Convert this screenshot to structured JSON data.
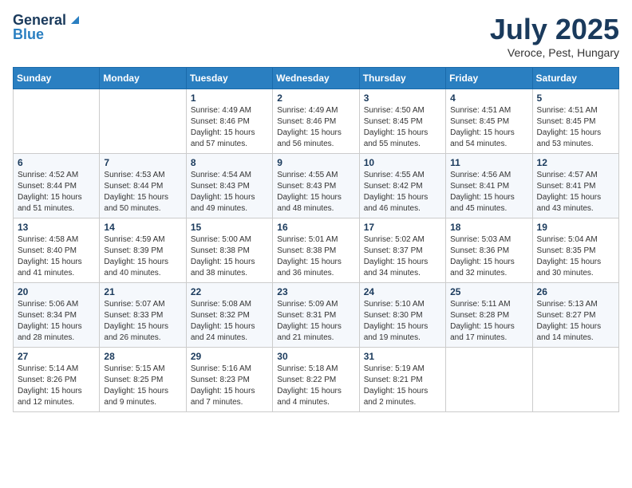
{
  "logo": {
    "general": "General",
    "blue": "Blue"
  },
  "title": {
    "month": "July 2025",
    "location": "Veroce, Pest, Hungary"
  },
  "days_header": [
    "Sunday",
    "Monday",
    "Tuesday",
    "Wednesday",
    "Thursday",
    "Friday",
    "Saturday"
  ],
  "weeks": [
    [
      {
        "day": "",
        "info": ""
      },
      {
        "day": "",
        "info": ""
      },
      {
        "day": "1",
        "info": "Sunrise: 4:49 AM\nSunset: 8:46 PM\nDaylight: 15 hours and 57 minutes."
      },
      {
        "day": "2",
        "info": "Sunrise: 4:49 AM\nSunset: 8:46 PM\nDaylight: 15 hours and 56 minutes."
      },
      {
        "day": "3",
        "info": "Sunrise: 4:50 AM\nSunset: 8:45 PM\nDaylight: 15 hours and 55 minutes."
      },
      {
        "day": "4",
        "info": "Sunrise: 4:51 AM\nSunset: 8:45 PM\nDaylight: 15 hours and 54 minutes."
      },
      {
        "day": "5",
        "info": "Sunrise: 4:51 AM\nSunset: 8:45 PM\nDaylight: 15 hours and 53 minutes."
      }
    ],
    [
      {
        "day": "6",
        "info": "Sunrise: 4:52 AM\nSunset: 8:44 PM\nDaylight: 15 hours and 51 minutes."
      },
      {
        "day": "7",
        "info": "Sunrise: 4:53 AM\nSunset: 8:44 PM\nDaylight: 15 hours and 50 minutes."
      },
      {
        "day": "8",
        "info": "Sunrise: 4:54 AM\nSunset: 8:43 PM\nDaylight: 15 hours and 49 minutes."
      },
      {
        "day": "9",
        "info": "Sunrise: 4:55 AM\nSunset: 8:43 PM\nDaylight: 15 hours and 48 minutes."
      },
      {
        "day": "10",
        "info": "Sunrise: 4:55 AM\nSunset: 8:42 PM\nDaylight: 15 hours and 46 minutes."
      },
      {
        "day": "11",
        "info": "Sunrise: 4:56 AM\nSunset: 8:41 PM\nDaylight: 15 hours and 45 minutes."
      },
      {
        "day": "12",
        "info": "Sunrise: 4:57 AM\nSunset: 8:41 PM\nDaylight: 15 hours and 43 minutes."
      }
    ],
    [
      {
        "day": "13",
        "info": "Sunrise: 4:58 AM\nSunset: 8:40 PM\nDaylight: 15 hours and 41 minutes."
      },
      {
        "day": "14",
        "info": "Sunrise: 4:59 AM\nSunset: 8:39 PM\nDaylight: 15 hours and 40 minutes."
      },
      {
        "day": "15",
        "info": "Sunrise: 5:00 AM\nSunset: 8:38 PM\nDaylight: 15 hours and 38 minutes."
      },
      {
        "day": "16",
        "info": "Sunrise: 5:01 AM\nSunset: 8:38 PM\nDaylight: 15 hours and 36 minutes."
      },
      {
        "day": "17",
        "info": "Sunrise: 5:02 AM\nSunset: 8:37 PM\nDaylight: 15 hours and 34 minutes."
      },
      {
        "day": "18",
        "info": "Sunrise: 5:03 AM\nSunset: 8:36 PM\nDaylight: 15 hours and 32 minutes."
      },
      {
        "day": "19",
        "info": "Sunrise: 5:04 AM\nSunset: 8:35 PM\nDaylight: 15 hours and 30 minutes."
      }
    ],
    [
      {
        "day": "20",
        "info": "Sunrise: 5:06 AM\nSunset: 8:34 PM\nDaylight: 15 hours and 28 minutes."
      },
      {
        "day": "21",
        "info": "Sunrise: 5:07 AM\nSunset: 8:33 PM\nDaylight: 15 hours and 26 minutes."
      },
      {
        "day": "22",
        "info": "Sunrise: 5:08 AM\nSunset: 8:32 PM\nDaylight: 15 hours and 24 minutes."
      },
      {
        "day": "23",
        "info": "Sunrise: 5:09 AM\nSunset: 8:31 PM\nDaylight: 15 hours and 21 minutes."
      },
      {
        "day": "24",
        "info": "Sunrise: 5:10 AM\nSunset: 8:30 PM\nDaylight: 15 hours and 19 minutes."
      },
      {
        "day": "25",
        "info": "Sunrise: 5:11 AM\nSunset: 8:28 PM\nDaylight: 15 hours and 17 minutes."
      },
      {
        "day": "26",
        "info": "Sunrise: 5:13 AM\nSunset: 8:27 PM\nDaylight: 15 hours and 14 minutes."
      }
    ],
    [
      {
        "day": "27",
        "info": "Sunrise: 5:14 AM\nSunset: 8:26 PM\nDaylight: 15 hours and 12 minutes."
      },
      {
        "day": "28",
        "info": "Sunrise: 5:15 AM\nSunset: 8:25 PM\nDaylight: 15 hours and 9 minutes."
      },
      {
        "day": "29",
        "info": "Sunrise: 5:16 AM\nSunset: 8:23 PM\nDaylight: 15 hours and 7 minutes."
      },
      {
        "day": "30",
        "info": "Sunrise: 5:18 AM\nSunset: 8:22 PM\nDaylight: 15 hours and 4 minutes."
      },
      {
        "day": "31",
        "info": "Sunrise: 5:19 AM\nSunset: 8:21 PM\nDaylight: 15 hours and 2 minutes."
      },
      {
        "day": "",
        "info": ""
      },
      {
        "day": "",
        "info": ""
      }
    ]
  ]
}
